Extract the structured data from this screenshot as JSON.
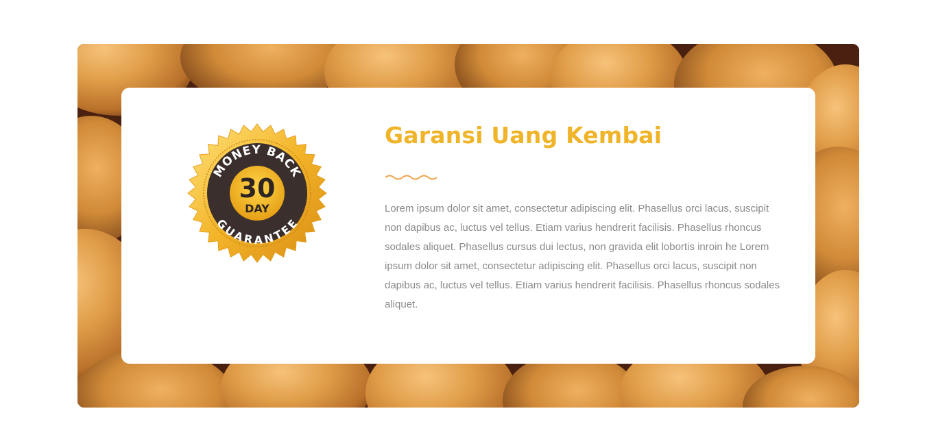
{
  "badge": {
    "top_text": "MONEY BACK",
    "number": "30",
    "unit": "DAY",
    "bottom_text": "GUARANTEE"
  },
  "section": {
    "title": "Garansi Uang Kembai",
    "description": "Lorem ipsum dolor sit amet, consectetur adipiscing elit. Phasellus orci lacus, suscipit non dapibus ac, luctus vel tellus. Etiam varius hendrerit facilisis. Phasellus rhoncus sodales aliquet. Phasellus cursus dui lectus, non gravida elit lobortis inroin he Lorem ipsum dolor sit amet, consectetur adipiscing elit. Phasellus orci lacus, suscipit non dapibus ac, luctus vel tellus. Etiam varius hendrerit facilisis. Phasellus rhoncus sodales aliquet."
  },
  "colors": {
    "accent": "#f0b429",
    "wave": "#f0a24a",
    "text": "#8a8a8a",
    "background_dark": "#4a2010",
    "potato": "#d9953e"
  },
  "icons": {
    "badge": "money-back-guarantee-seal-icon",
    "divider": "wavy-divider-icon"
  }
}
